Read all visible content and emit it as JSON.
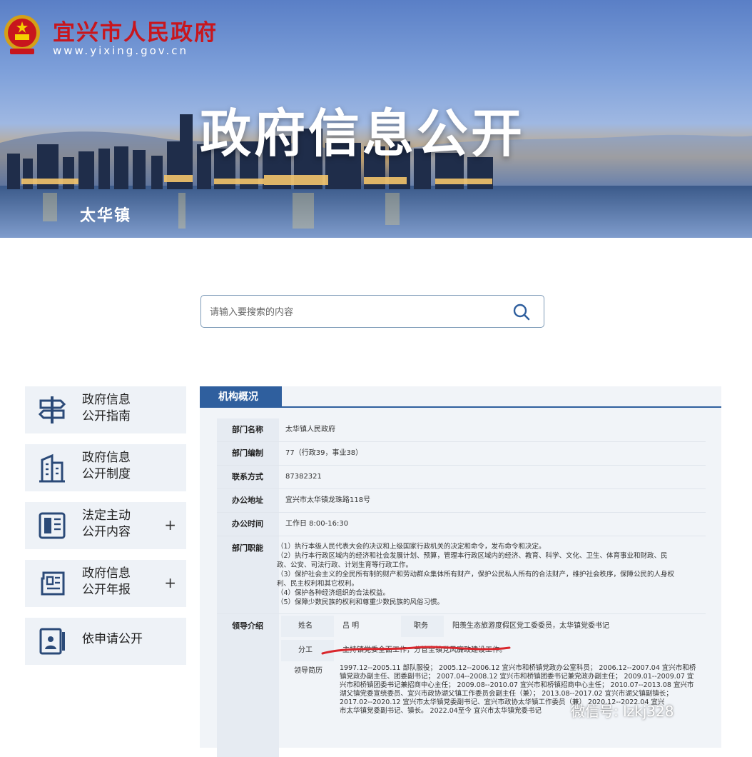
{
  "header": {
    "site_name": "宜兴市人民政府",
    "site_url": "www.yixing.gov.cn",
    "hero_title": "政府信息公开",
    "town": "太华镇"
  },
  "search": {
    "placeholder": "请输入要搜索的内容"
  },
  "sidebar": {
    "items": [
      {
        "line1": "政府信息",
        "line2": "公开指南",
        "has_plus": false,
        "icon": "signpost-icon"
      },
      {
        "line1": "政府信息",
        "line2": "公开制度",
        "has_plus": false,
        "icon": "building-icon"
      },
      {
        "line1": "法定主动",
        "line2": "公开内容",
        "has_plus": true,
        "plus": "+",
        "icon": "document-icon"
      },
      {
        "line1": "政府信息",
        "line2": "公开年报",
        "has_plus": true,
        "plus": "+",
        "icon": "newspaper-icon"
      },
      {
        "line1": "依申请公开",
        "line2": "",
        "has_plus": false,
        "icon": "id-card-icon"
      }
    ]
  },
  "panel": {
    "tab": "机构概况",
    "rows": [
      {
        "label": "部门名称",
        "value": "太华镇人民政府"
      },
      {
        "label": "部门编制",
        "value": "77（行政39，事业38）"
      },
      {
        "label": "联系方式",
        "value": "87382321"
      },
      {
        "label": "办公地址",
        "value": "宜兴市太华镇龙珠路118号"
      },
      {
        "label": "办公时间",
        "value": "工作日 8:00-16:30"
      }
    ],
    "duties_label": "部门职能",
    "duties": [
      "（1）执行本级人民代表大会的决议和上级国家行政机关的决定和命令，发布命令和决定。",
      "（2）执行本行政区域内的经济和社会发展计划、预算，管理本行政区域内的经济、教育、科学、文化、卫生、体育事业和财政、民",
      "政、公安、司法行政、计划生育等行政工作。",
      "（3）保护社会主义的全民所有制的财产和劳动群众集体所有财产，保护公民私人所有的合法财产，维护社会秩序，保障公民的人身权",
      "利、民主权利和其它权利。",
      "（4）保护各种经济组织的合法权益。",
      "（5）保障少数民族的权利和尊重少数民族的风俗习惯。"
    ],
    "leader_label": "领导介绍",
    "leader": {
      "name_label": "姓名",
      "name_value": "吕  明",
      "position_label": "职务",
      "position_value": "阳羡生态旅游度假区党工委委员，太华镇党委书记",
      "division_label": "分工",
      "division_value": "主持镇党委全面工作，分管全镇党风廉政建设工作。",
      "resume_label": "领导简历",
      "resume_lines": [
        "1997.12--2005.11 部队服役；  2005.12--2006.12 宜兴市和桥镇党政办公室科员；  2006.12--2007.04 宜兴市和桥",
        "镇党政办副主任、团委副书记；  2007.04--2008.12 宜兴市和桥镇团委书记兼党政办副主任；  2009.01--2009.07 宜",
        "兴市和桥镇团委书记兼招商中心主任；  2009.08--2010.07 宜兴市和桥镇招商中心主任；  2010.07--2013.08 宜兴市",
        "湖父镇党委宣统委员、宜兴市政协湖父镇工作委员会副主任（兼）；  2013.08--2017.02 宜兴市湖父镇副镇长；",
        "2017.02--2020.12 宜兴市太华镇党委副书记、宜兴市政协太华镇工作委员（兼）  2020.12--2022.04 宜兴",
        "市太华镇党委副书记、镇长。 2022.04至今 宜兴市太华镇党委书记"
      ]
    }
  },
  "watermark": "微信号: lzkj328",
  "colors": {
    "accent": "#2f5f9e",
    "site_name_red": "#c8161d",
    "annotation_red": "#d9262c"
  }
}
